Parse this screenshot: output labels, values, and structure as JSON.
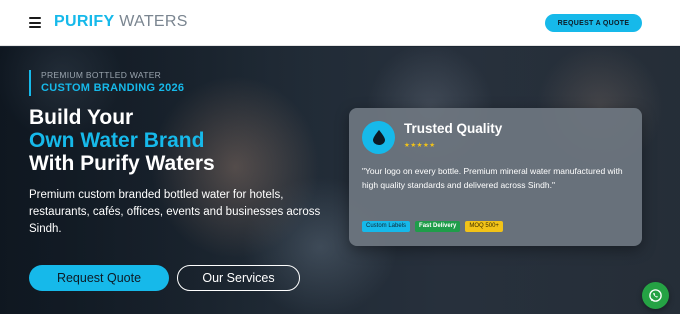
{
  "navbar": {
    "menu_icon": "hamburger-menu-icon",
    "logo_bold": "PURIFY",
    "logo_light": "WATERS",
    "cta_label": "REQUEST A QUOTE"
  },
  "hero": {
    "eyebrow_line1": "PREMIUM BOTTLED WATER",
    "eyebrow_line2": "CUSTOM BRANDING 2026",
    "headline_line1": "Build Your",
    "headline_line2": "Own Water Brand",
    "headline_line3": "With Purify Waters",
    "description": "Premium custom branded bottled water for hotels, restaurants, cafés, offices, events and businesses across Sindh.",
    "primary_button": "Request Quote",
    "secondary_button": "Our Services"
  },
  "card": {
    "icon": "water-drop-icon",
    "title": "Trusted Quality",
    "stars": "★★★★★",
    "rating": 5,
    "quote": "\"Your logo on every bottle. Premium mineral water manufactured with high quality standards and delivered across Sindh.\"",
    "tags": [
      "Custom Labels",
      "Fast Delivery",
      "MOQ 500+"
    ]
  },
  "whatsapp": {
    "icon": "whatsapp-icon"
  },
  "colors": {
    "accent": "#16b9ea",
    "star": "#f2c318",
    "tag_green": "#1f9d4a",
    "whatsapp_green": "#25a244"
  }
}
